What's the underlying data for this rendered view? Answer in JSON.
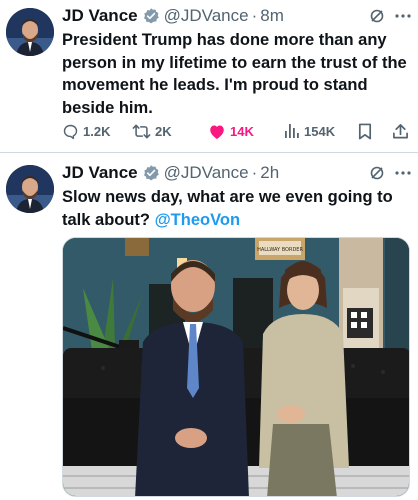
{
  "tweets": [
    {
      "author_name": "JD Vance",
      "handle": "@JDVance",
      "separator": "·",
      "time": "8m",
      "text": "President Trump has done more than any person in my lifetime to earn the trust of the movement he leads. I'm proud to stand beside him.",
      "stats": {
        "replies": "1.2K",
        "reposts": "2K",
        "likes": "14K",
        "views": "154K"
      }
    },
    {
      "author_name": "JD Vance",
      "handle": "@JDVance",
      "separator": "·",
      "time": "2h",
      "text_prefix": "Slow news day, what are we even going to talk about? ",
      "mention": "@TheoVon",
      "media_poster_text": "HALLWAY BORDER"
    }
  ],
  "icons": {
    "verified": "verified-badge-icon",
    "grok": "grok-icon",
    "more": "more-icon",
    "reply": "reply-icon",
    "repost": "repost-icon",
    "like": "heart-icon",
    "views": "views-icon",
    "bookmark": "bookmark-icon",
    "share": "share-icon"
  },
  "colors": {
    "text": "#0f1419",
    "secondary": "#536471",
    "link": "#1d9bf0",
    "like_active": "#f91880",
    "verified": "#829aab"
  }
}
